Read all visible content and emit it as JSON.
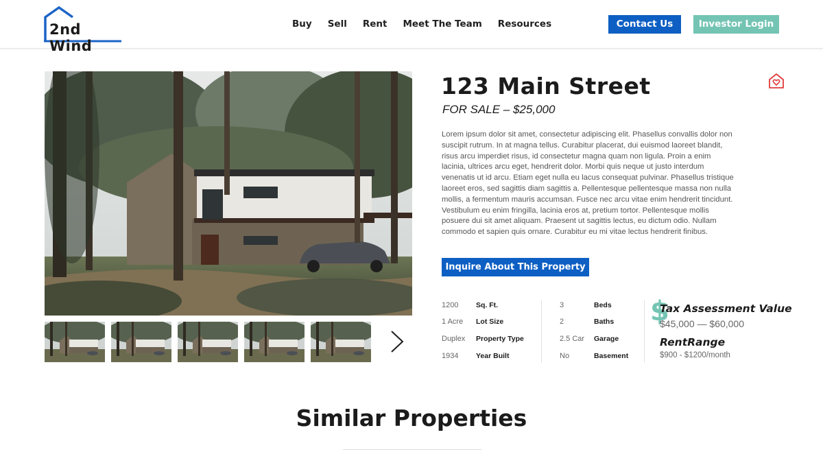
{
  "header": {
    "logo_text": "2nd Wind",
    "nav": [
      "Buy",
      "Sell",
      "Rent",
      "Meet The Team",
      "Resources"
    ],
    "contact_label": "Contact Us",
    "investor_label": "Investor Login"
  },
  "colors": {
    "brand_blue": "#0d5fc3",
    "accent_teal": "#74c4b4",
    "favorite_red": "#e03a3a"
  },
  "gallery": {
    "thumbnail_count": 5,
    "next_icon": "chevron-right-icon"
  },
  "property": {
    "title": "123 Main Street",
    "subtitle": "FOR SALE – $25,000",
    "description": "Lorem ipsum dolor sit amet, consectetur adipiscing elit. Phasellus convallis dolor non suscipit rutrum. In at magna tellus. Curabitur placerat, dui euismod laoreet blandit, risus arcu imperdiet risus, id consectetur magna quam non ligula. Proin a enim lacinia, ultrices arcu eget, hendrerit dolor. Morbi quis neque ut justo interdum venenatis ut id arcu. Etiam eget nulla eu lacus consequat pulvinar. Phasellus tristique laoreet eros, sed sagittis diam sagittis a. Pellentesque pellentesque massa non nulla mollis, a fermentum mauris accumsan. Fusce nec arcu vitae enim hendrerit tincidunt. Vestibulum eu enim fringilla, lacinia eros at, pretium tortor. Pellentesque mollis posuere dui sit amet aliquam. Praesent ut sagittis lectus, eu dictum odio. Nullam commodo et sapien quis ornare. Curabitur eu mi vitae lectus hendrerit finibus.",
    "inquire_label": "Inquire About This Property",
    "favorite_icon": "heart-house-icon"
  },
  "stats_left": [
    {
      "value": "1200",
      "label": "Sq. Ft."
    },
    {
      "value": "1 Acre",
      "label": "Lot Size"
    },
    {
      "value": "Duplex",
      "label": "Property Type"
    },
    {
      "value": "1934",
      "label": "Year Built"
    }
  ],
  "stats_right": [
    {
      "value": "3",
      "label": "Beds"
    },
    {
      "value": "2",
      "label": "Baths"
    },
    {
      "value": "2.5 Car",
      "label": "Garage"
    },
    {
      "value": "No",
      "label": "Basement"
    }
  ],
  "valuation": {
    "icon_glyph": "$",
    "tax_title": "Tax Assessment Value",
    "tax_range": "$45,000 — $60,000",
    "rent_title": "RentRange",
    "rent_range": "$900 - $1200/month"
  },
  "similar": {
    "heading": "Similar Properties"
  }
}
